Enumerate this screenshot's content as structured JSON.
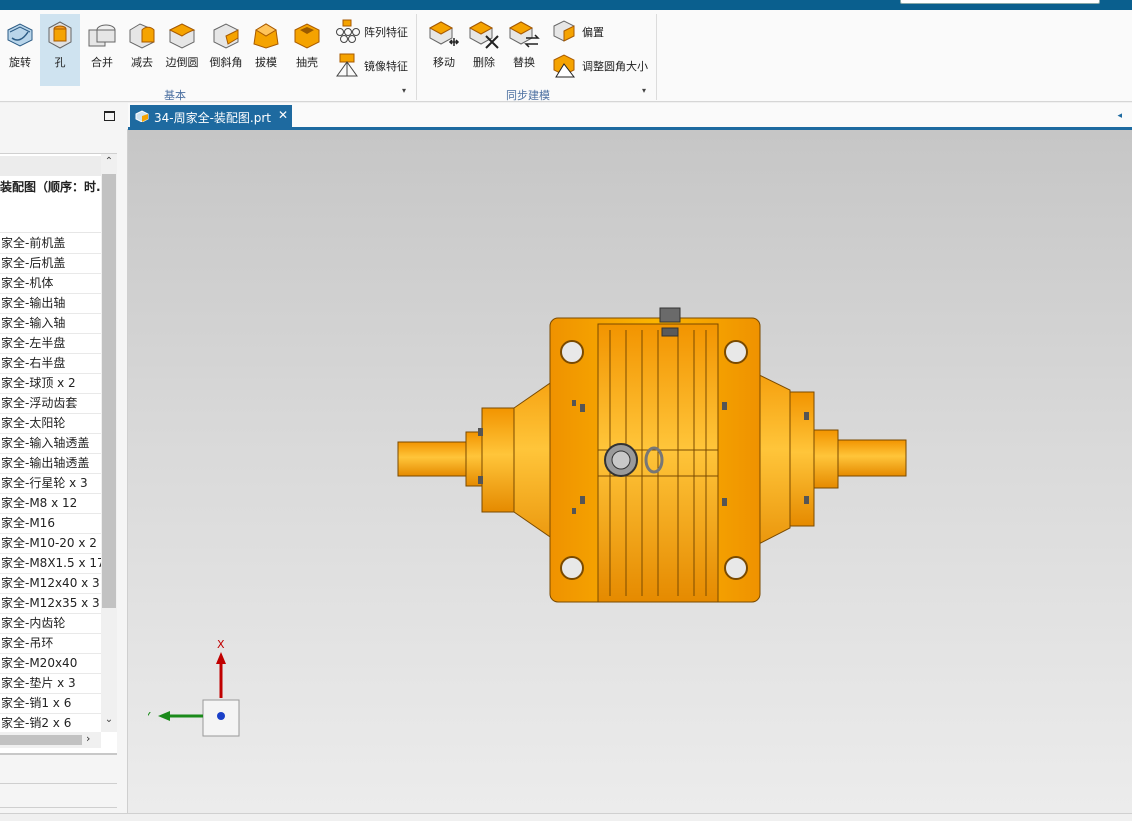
{
  "ribbon": {
    "buttons": [
      {
        "label": "旋转",
        "icon": "revolve-icon"
      },
      {
        "label": "孔",
        "icon": "hole-icon"
      },
      {
        "label": "合并",
        "icon": "unite-icon"
      },
      {
        "label": "减去",
        "icon": "subtract-icon"
      },
      {
        "label": "边倒圆",
        "icon": "edge-blend-icon"
      },
      {
        "label": "倒斜角",
        "icon": "chamfer-icon"
      },
      {
        "label": "拔模",
        "icon": "draft-icon"
      },
      {
        "label": "抽壳",
        "icon": "shell-icon"
      }
    ],
    "small_buttons": [
      {
        "label": "阵列特征",
        "icon": "pattern-feature-icon"
      },
      {
        "label": "镜像特征",
        "icon": "mirror-feature-icon"
      }
    ],
    "sync_buttons": [
      {
        "label": "移动",
        "icon": "move-face-icon"
      },
      {
        "label": "删除",
        "icon": "delete-face-icon"
      },
      {
        "label": "替换",
        "icon": "replace-face-icon"
      }
    ],
    "sync_small_buttons": [
      {
        "label": "偏置",
        "icon": "offset-face-icon"
      },
      {
        "label": "调整圆角大小",
        "icon": "resize-blend-icon"
      }
    ],
    "group_basic": "基本",
    "group_sync": "同步建模"
  },
  "tree": {
    "root": "装配图（顺序：时.",
    "rows": [
      "家全-前机盖",
      "家全-后机盖",
      "家全-机体",
      "家全-输出轴",
      "家全-输入轴",
      "家全-左半盘",
      "家全-右半盘",
      "家全-球顶 x 2",
      "家全-浮动齿套",
      "家全-太阳轮",
      "家全-输入轴透盖",
      "家全-输出轴透盖",
      "家全-行星轮 x 3",
      "家全-M8 x 12",
      "家全-M16",
      "家全-M10-20 x 2",
      "家全-M8X1.5 x 17",
      "家全-M12x40 x 3",
      "家全-M12x35 x 3",
      "家全-内齿轮",
      "家全-吊环",
      "家全-M20x40",
      "家全-垫片 x 3",
      "家全-销1 x 6",
      "家全-销2 x 6"
    ]
  },
  "tab": {
    "label": "34-周家全-装配图.prt",
    "close": "✕"
  },
  "triad": {
    "x_label": "X",
    "y_label": "Y"
  },
  "colors": {
    "accent": "#1e6aa0",
    "model": "#f5a300",
    "model_dark": "#c07a00"
  }
}
